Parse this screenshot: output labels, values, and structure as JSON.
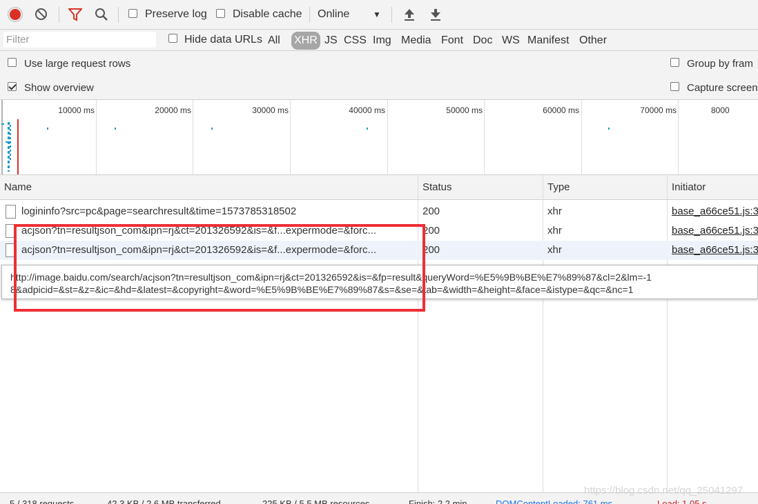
{
  "toolbar": {
    "preserve_log": "Preserve log",
    "disable_cache": "Disable cache",
    "throttling": "Online"
  },
  "filterbar": {
    "placeholder": "Filter",
    "hide_data_urls": "Hide data URLs",
    "types": [
      "All",
      "XHR",
      "JS",
      "CSS",
      "Img",
      "Media",
      "Font",
      "Doc",
      "WS",
      "Manifest",
      "Other"
    ],
    "active_type": "XHR"
  },
  "settings": {
    "large_rows": "Use large request rows",
    "show_overview": "Show overview",
    "group_by_frame": "Group by fram",
    "capture_screenshots": "Capture screen"
  },
  "overview": {
    "ticks": [
      "10000 ms",
      "20000 ms",
      "30000 ms",
      "40000 ms",
      "50000 ms",
      "60000 ms",
      "70000 ms",
      "8000"
    ]
  },
  "table": {
    "headers": {
      "name": "Name",
      "status": "Status",
      "type": "Type",
      "initiator": "Initiator"
    },
    "rows": [
      {
        "name": "logininfo?src=pc&page=searchresult&time=1573785318502",
        "status": "200",
        "type": "xhr",
        "initiator": "base_a66ce51.js:3"
      },
      {
        "name": "acjson?tn=resultjson_com&ipn=rj&ct=201326592&is=&f...expermode=&forc...",
        "status": "200",
        "type": "xhr",
        "initiator": "base_a66ce51.js:3"
      },
      {
        "name": "acjson?tn=resultjson_com&ipn=rj&ct=201326592&is=&f...expermode=&forc...",
        "status": "200",
        "type": "xhr",
        "initiator": "base_a66ce51.js:3"
      }
    ]
  },
  "tooltip": {
    "line1": "http://image.baidu.com/search/acjson?tn=resultjson_com&ipn=rj&ct=201326592&is=&fp=result&queryWord=%E5%9B%BE%E7%89%87&cl=2&lm=-1",
    "line2": "8&adpicid=&st=&z=&ic=&hd=&latest=&copyright=&word=%E5%9B%BE%E7%89%87&s=&se=&tab=&width=&height=&face=&istype=&qc=&nc=1"
  },
  "statusbar": {
    "requests": "5 / 318 requests",
    "transferred": "42.3 KB / 2.6 MB transferred",
    "resources": "225 KB / 5.5 MB resources",
    "finish": "Finish: 2.2 min",
    "domcontentloaded": "DOMContentLoaded: 761 ms",
    "load": "Load: 1.05 s"
  },
  "watermark": "https://blog.csdn.net/qq_25041297",
  "colors": {
    "accent_record": "#d93025",
    "highlight_box": "#ee2e35",
    "link_blue": "#1a73e8",
    "load_red": "#c5221f"
  }
}
